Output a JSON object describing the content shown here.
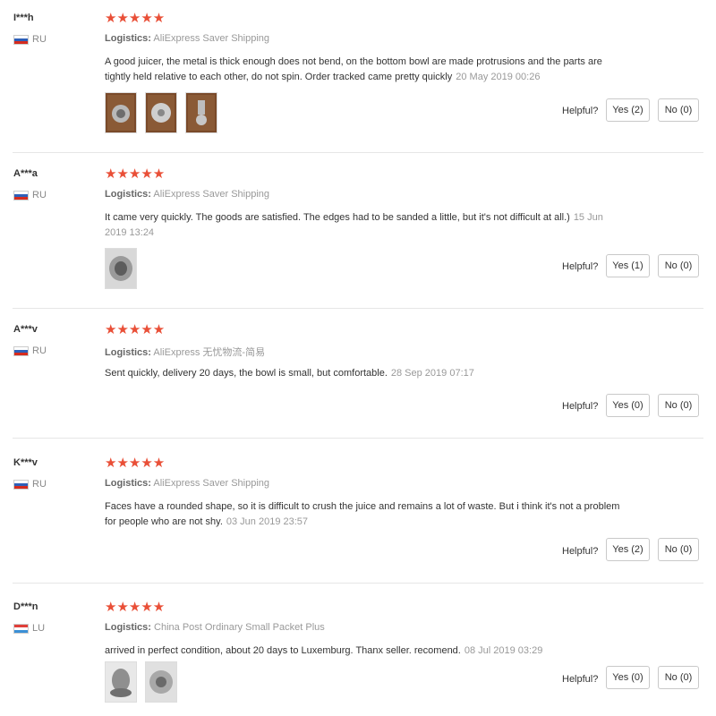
{
  "reviews": [
    {
      "user": "I***h",
      "country": "RU",
      "stars": "★★★★★",
      "logistics_label": "Logistics:",
      "logistics": "AliExpress Saver Shipping",
      "text": "A good juicer, the metal is thick enough does not bend, on the bottom bowl are made protrusions and the parts are tightly held relative to each other, do not spin. Order tracked came pretty quickly",
      "date": "20 May 2019 00:26",
      "photos": 3,
      "helpful_label": "Helpful?",
      "yes": "Yes (2)",
      "no": "No (0)"
    },
    {
      "user": "A***a",
      "country": "RU",
      "stars": "★★★★★",
      "logistics_label": "Logistics:",
      "logistics": "AliExpress Saver Shipping",
      "text": "It came very quickly. The goods are satisfied. The edges had to be sanded a little, but it's not difficult at all.)",
      "date": "15 Jun 2019 13:24",
      "photos": 1,
      "helpful_label": "Helpful?",
      "yes": "Yes (1)",
      "no": "No (0)"
    },
    {
      "user": "A***v",
      "country": "RU",
      "stars": "★★★★★",
      "logistics_label": "Logistics:",
      "logistics": "AliExpress 无忧物流-简易",
      "text": "Sent quickly, delivery 20 days, the bowl is small, but comfortable.",
      "date": "28 Sep 2019 07:17",
      "photos": 0,
      "helpful_label": "Helpful?",
      "yes": "Yes (0)",
      "no": "No (0)"
    },
    {
      "user": "K***v",
      "country": "RU",
      "stars": "★★★★★",
      "logistics_label": "Logistics:",
      "logistics": "AliExpress Saver Shipping",
      "text": "Faces have a rounded shape, so it is difficult to crush the juice and remains a lot of waste. But i think it's not a problem for people who are not shy.",
      "date": "03 Jun 2019 23:57",
      "photos": 0,
      "helpful_label": "Helpful?",
      "yes": "Yes (2)",
      "no": "No (0)"
    },
    {
      "user": "D***n",
      "country": "LU",
      "stars": "★★★★★",
      "logistics_label": "Logistics:",
      "logistics": "China Post Ordinary Small Packet Plus",
      "text": "arrived in perfect condition, about 20 days to Luxemburg. Thanx seller. recomend.",
      "date": "08 Jul 2019 03:29",
      "photos": 2,
      "helpful_label": "Helpful?",
      "yes": "Yes (0)",
      "no": "No (0)"
    }
  ]
}
